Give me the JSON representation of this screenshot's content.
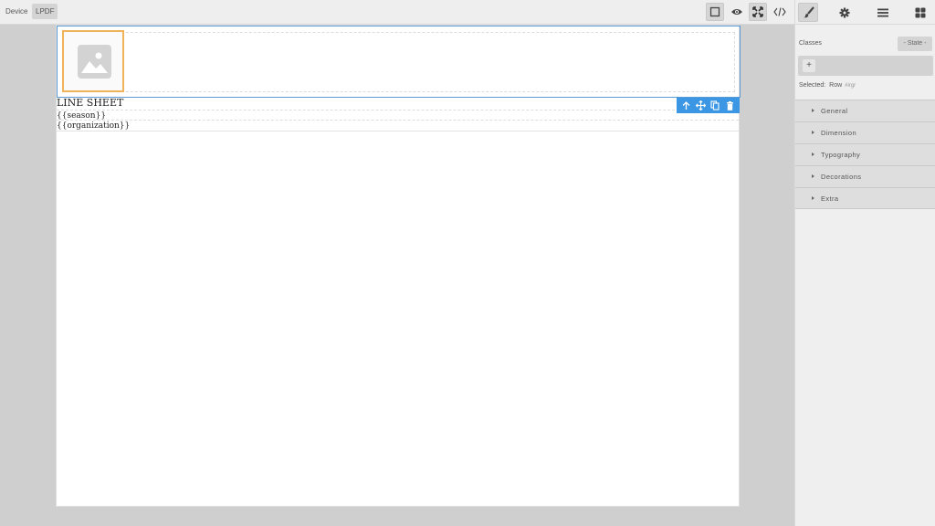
{
  "topbar": {
    "device_label": "Device",
    "device_value": "LPDF",
    "buttons": [
      {
        "name": "sw-visibility",
        "icon": "square-outline-icon",
        "active": true
      },
      {
        "name": "preview",
        "icon": "eye-icon",
        "active": false
      },
      {
        "name": "fullscreen",
        "icon": "expand-icon",
        "active": true
      },
      {
        "name": "export-code",
        "icon": "code-icon",
        "active": false
      }
    ]
  },
  "panel_tabs": [
    {
      "name": "style-manager",
      "icon": "paintbrush-icon",
      "active": true
    },
    {
      "name": "settings",
      "icon": "gear-icon",
      "active": false
    },
    {
      "name": "layers",
      "icon": "menu-icon",
      "active": false
    },
    {
      "name": "blocks",
      "icon": "grid-icon",
      "active": false
    }
  ],
  "style_panel": {
    "classes_label": "Classes",
    "state_label": "- State -",
    "add_class": "+",
    "selected_label": "Selected:",
    "selected_name": "Row",
    "selected_id": "#irgr",
    "sectors": [
      "General",
      "Dimension",
      "Typography",
      "Decorations",
      "Extra"
    ]
  },
  "canvas": {
    "title": "LINE SHEET",
    "season": "{{season}}",
    "organization": "{{organization}}"
  },
  "colors": {
    "selection": "#5a9bd6",
    "toolbar": "#3b97e3",
    "image_highlight": "#f0b35a"
  }
}
